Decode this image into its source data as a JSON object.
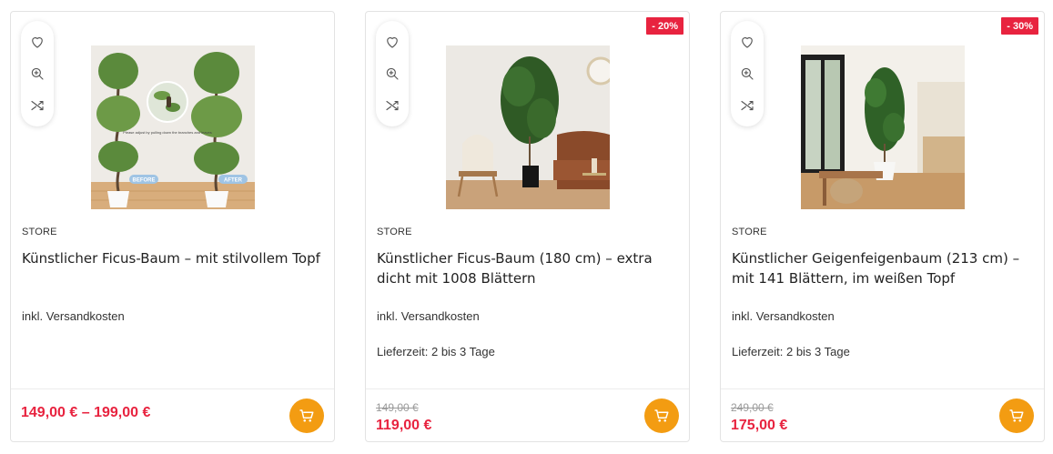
{
  "products": [
    {
      "store": "STORE",
      "title": "Künstlicher Ficus-Baum – mit stilvollem Topf",
      "shipping": "inkl. Versandkosten",
      "price": "149,00 € – 199,00 €",
      "image_text": {
        "note": "Please adjust by pulling down the branches and leaves",
        "before": "BEFORE",
        "after": "AFTER"
      }
    },
    {
      "badge": "- 20%",
      "store": "STORE",
      "title": "Künstlicher Ficus-Baum (180 cm) – extra dicht mit 1008 Blättern",
      "shipping": "inkl. Versandkosten",
      "delivery": "Lieferzeit: 2 bis 3 Tage",
      "old_price": "149,00 €",
      "price": "119,00 €"
    },
    {
      "badge": "- 30%",
      "store": "STORE",
      "title": "Künstlicher Geigenfeigenbaum (213 cm) – mit 141 Blättern, im weißen Topf",
      "shipping": "inkl. Versandkosten",
      "delivery": "Lieferzeit: 2 bis 3 Tage",
      "old_price": "249,00 €",
      "price": "175,00 €"
    }
  ],
  "icons": {
    "wishlist": "heart-icon",
    "quickview": "zoom-in-icon",
    "compare": "shuffle-icon",
    "cart": "cart-icon"
  },
  "colors": {
    "sale": "#e8233f",
    "cart_button": "#f39c12"
  }
}
